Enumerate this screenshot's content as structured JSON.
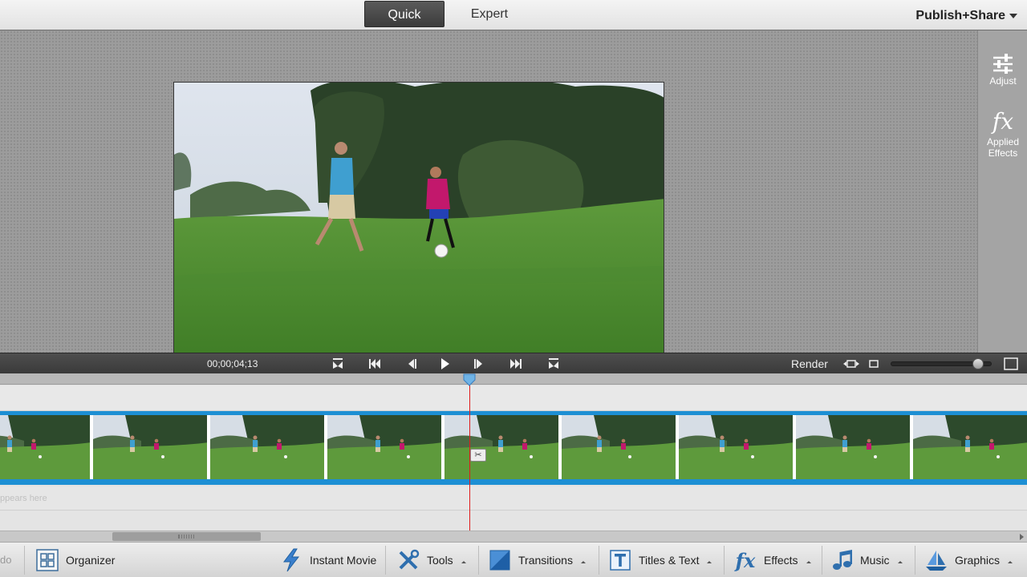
{
  "topbar": {
    "modes": [
      {
        "label": "Quick",
        "active": true
      },
      {
        "label": "Expert",
        "active": false
      }
    ],
    "publish_label": "Publish+Share"
  },
  "right_panel": {
    "adjust_label": "Adjust",
    "applied_effects_label": "Applied Effects"
  },
  "transport": {
    "timecode": "00;00;04;13",
    "render_label": "Render",
    "zoom_level": 0.92
  },
  "timeline": {
    "audio_hint": "ppears here",
    "frame_count": 9
  },
  "actionbar": {
    "undo_fragment": "do",
    "organizer_label": "Organizer",
    "instant_movie_label": "Instant Movie",
    "tools_label": "Tools",
    "transitions_label": "Transitions",
    "titles_label": "Titles & Text",
    "effects_label": "Effects",
    "music_label": "Music",
    "graphics_label": "Graphics"
  },
  "icons": {
    "adjust": "sliders-icon",
    "applied_effects": "fx-icon",
    "organizer": "organizer-grid-icon",
    "instant_movie": "lightning-icon",
    "tools": "tools-icon",
    "transitions": "transition-icon",
    "titles": "text-T-icon",
    "effects": "fx-icon",
    "music": "music-note-icon",
    "graphics": "sailboat-icon"
  },
  "colors": {
    "timeline_blue": "#1d8fd4",
    "playhead_red": "#e01b1b",
    "grass_green": "#5a9a3a"
  }
}
